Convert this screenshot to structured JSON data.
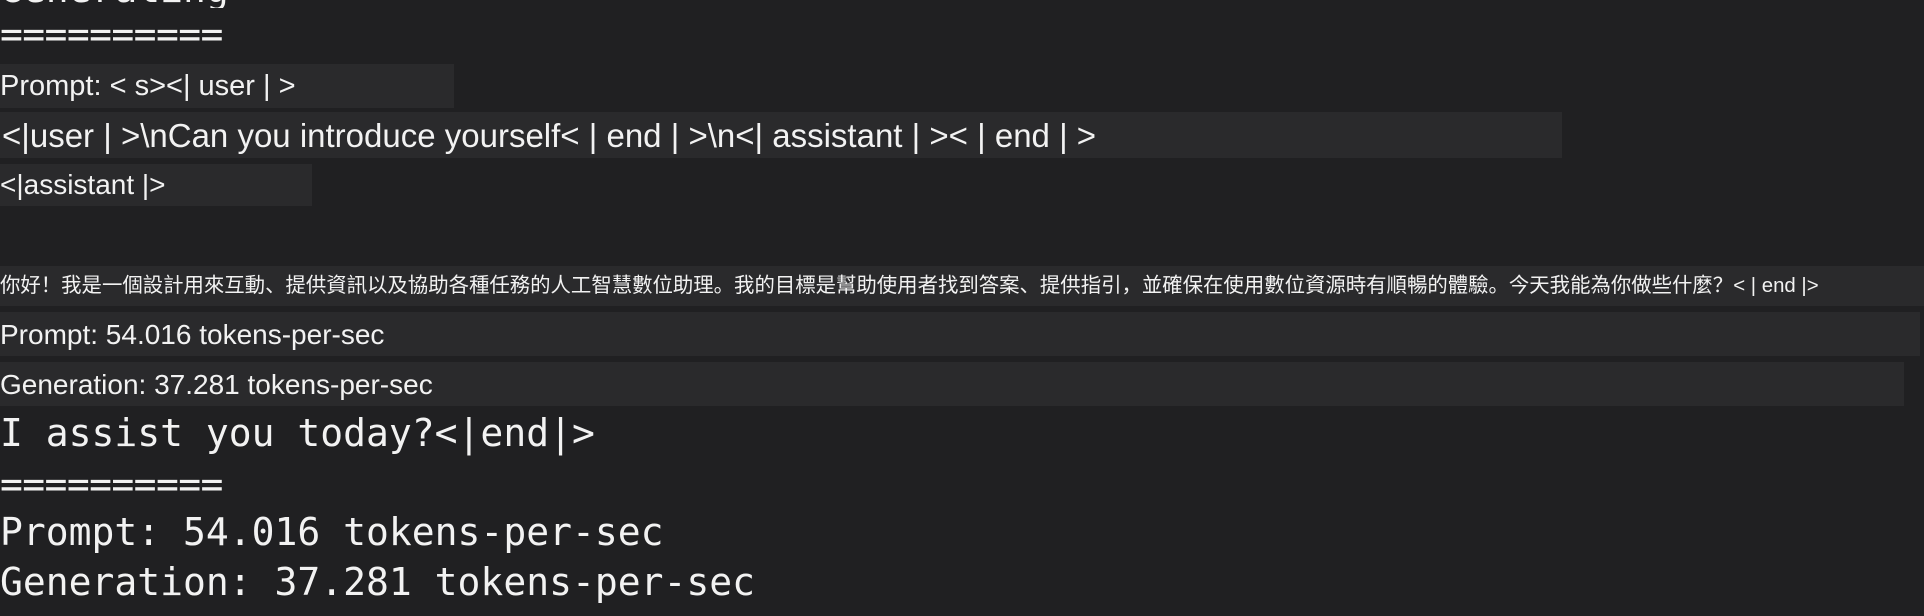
{
  "terminal": {
    "top_partial_text": "Generating",
    "separator_1": "==========",
    "overlay": {
      "prompt_label_line": "Prompt: < s><| user | >",
      "user_message_line": "<|user | >\\nCan you introduce yourself< | end | >\\n<| assistant | >< | end | >",
      "assistant_tag_line": "<|assistant |>",
      "chinese_response": "你好！我是一個設計用來互動、提供資訊以及協助各種任務的人工智慧數位助理。我的目標是幫助使用者找到答案、提供指引，並確保在使用數位資源時有順暢的體驗。今天我能為你做些什麼？< | end |>",
      "prompt_speed": "Prompt: 54.016 tokens-per-sec",
      "generation_speed": "Generation: 37.281 tokens-per-sec"
    },
    "assist_line": "I assist you today?<|end|>",
    "separator_2": "==========",
    "prompt_speed": "Prompt: 54.016 tokens-per-sec",
    "generation_speed": "Generation: 37.281 tokens-per-sec"
  },
  "colors": {
    "background": "#202022",
    "text": "#f2f2f2",
    "overlay_band": "#2a2a2c"
  }
}
